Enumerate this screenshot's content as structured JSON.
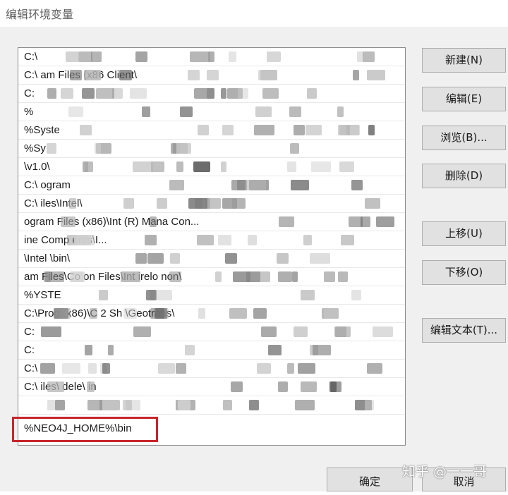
{
  "window": {
    "title": "编辑环境变量"
  },
  "paths": [
    "C:\\",
    "C:\\        am Files (x86           Client\\",
    "C:",
    "%",
    "%Syste",
    "%Sy",
    "                                         \\v1.0\\",
    "C:\\    ogram",
    "C:\\           iles\\Intel\\",
    "               ogram Files (x86)\\Int        (R) Mana                    Con...",
    "                                                   ine Comp     ents\\I...",
    "                        \\Intel     \\bin\\",
    "                 am Files\\Co       on Files\\Int        irelo         non\\",
    "%YSTE",
    "C:\\Prog            (x86)\\C                  2 Sh      \\Geotrans\\",
    "C:",
    "C:",
    "C:\\",
    "C:\\           iles\\                dele\\                  in",
    "",
    "%NEO4J_HOME%\\bin"
  ],
  "buttons": {
    "new": "新建(N)",
    "edit": "编辑(E)",
    "browse": "浏览(B)...",
    "delete": "删除(D)",
    "move_up": "上移(U)",
    "move_down": "下移(O)",
    "edit_text": "编辑文本(T)...",
    "ok": "确定",
    "cancel": "取消"
  },
  "watermark": "知乎 @一一哥",
  "colors": {
    "highlight_border": "#c7252b",
    "button_face": "#e1e1e1"
  }
}
